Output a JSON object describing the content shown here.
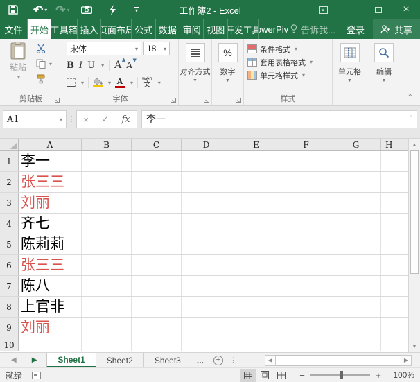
{
  "colors": {
    "accent": "#217346",
    "redText": "#d9534d",
    "ribbonBg": "#f3f3f3"
  },
  "titleBar": {
    "title": "工作簿2 - Excel"
  },
  "tabs": {
    "file": "文件",
    "items": [
      "开始",
      "工具箱",
      "插入",
      "页面布局",
      "公式",
      "数据",
      "审阅",
      "视图",
      "开发工具",
      "PowerPivot"
    ],
    "active": "开始",
    "tellMe": "告诉我...",
    "signIn": "登录",
    "share": "共享"
  },
  "ribbon": {
    "clipboard": {
      "paste": "粘贴",
      "label": "剪贴板"
    },
    "font": {
      "name": "宋体",
      "size": "18",
      "bold": "B",
      "italic": "I",
      "underline": "U",
      "grow": "A",
      "shrink": "A",
      "phoneticTop": "wén",
      "phoneticBottom": "文",
      "label": "字体"
    },
    "alignment": {
      "label": "对齐方式"
    },
    "number": {
      "symbol": "%",
      "label": "数字"
    },
    "styles": {
      "conditional": "条件格式",
      "formatAsTable": "套用表格格式",
      "cellStyles": "单元格样式",
      "label": "样式"
    },
    "cells": {
      "label": "单元格"
    },
    "editing": {
      "label": "编辑"
    }
  },
  "formulaBar": {
    "nameBox": "A1",
    "fx": "fx",
    "value": "李一"
  },
  "grid": {
    "columns": [
      "A",
      "B",
      "C",
      "D",
      "E",
      "F",
      "G",
      "H"
    ],
    "rows": [
      {
        "n": "1",
        "text": "李一",
        "red": false
      },
      {
        "n": "2",
        "text": "张三三",
        "red": true
      },
      {
        "n": "3",
        "text": "刘丽",
        "red": true
      },
      {
        "n": "4",
        "text": "齐七",
        "red": false
      },
      {
        "n": "5",
        "text": "陈莉莉",
        "red": false
      },
      {
        "n": "6",
        "text": "张三三",
        "red": true
      },
      {
        "n": "7",
        "text": "陈八",
        "red": false
      },
      {
        "n": "8",
        "text": "上官非",
        "red": false
      },
      {
        "n": "9",
        "text": "刘丽",
        "red": true
      },
      {
        "n": "10",
        "text": "",
        "red": false
      }
    ]
  },
  "sheetBar": {
    "sheets": [
      "Sheet1",
      "Sheet2",
      "Sheet3"
    ],
    "active": "Sheet1",
    "more": "..."
  },
  "statusBar": {
    "status": "就绪",
    "zoomOut": "−",
    "zoomIn": "+",
    "zoom": "100%"
  }
}
